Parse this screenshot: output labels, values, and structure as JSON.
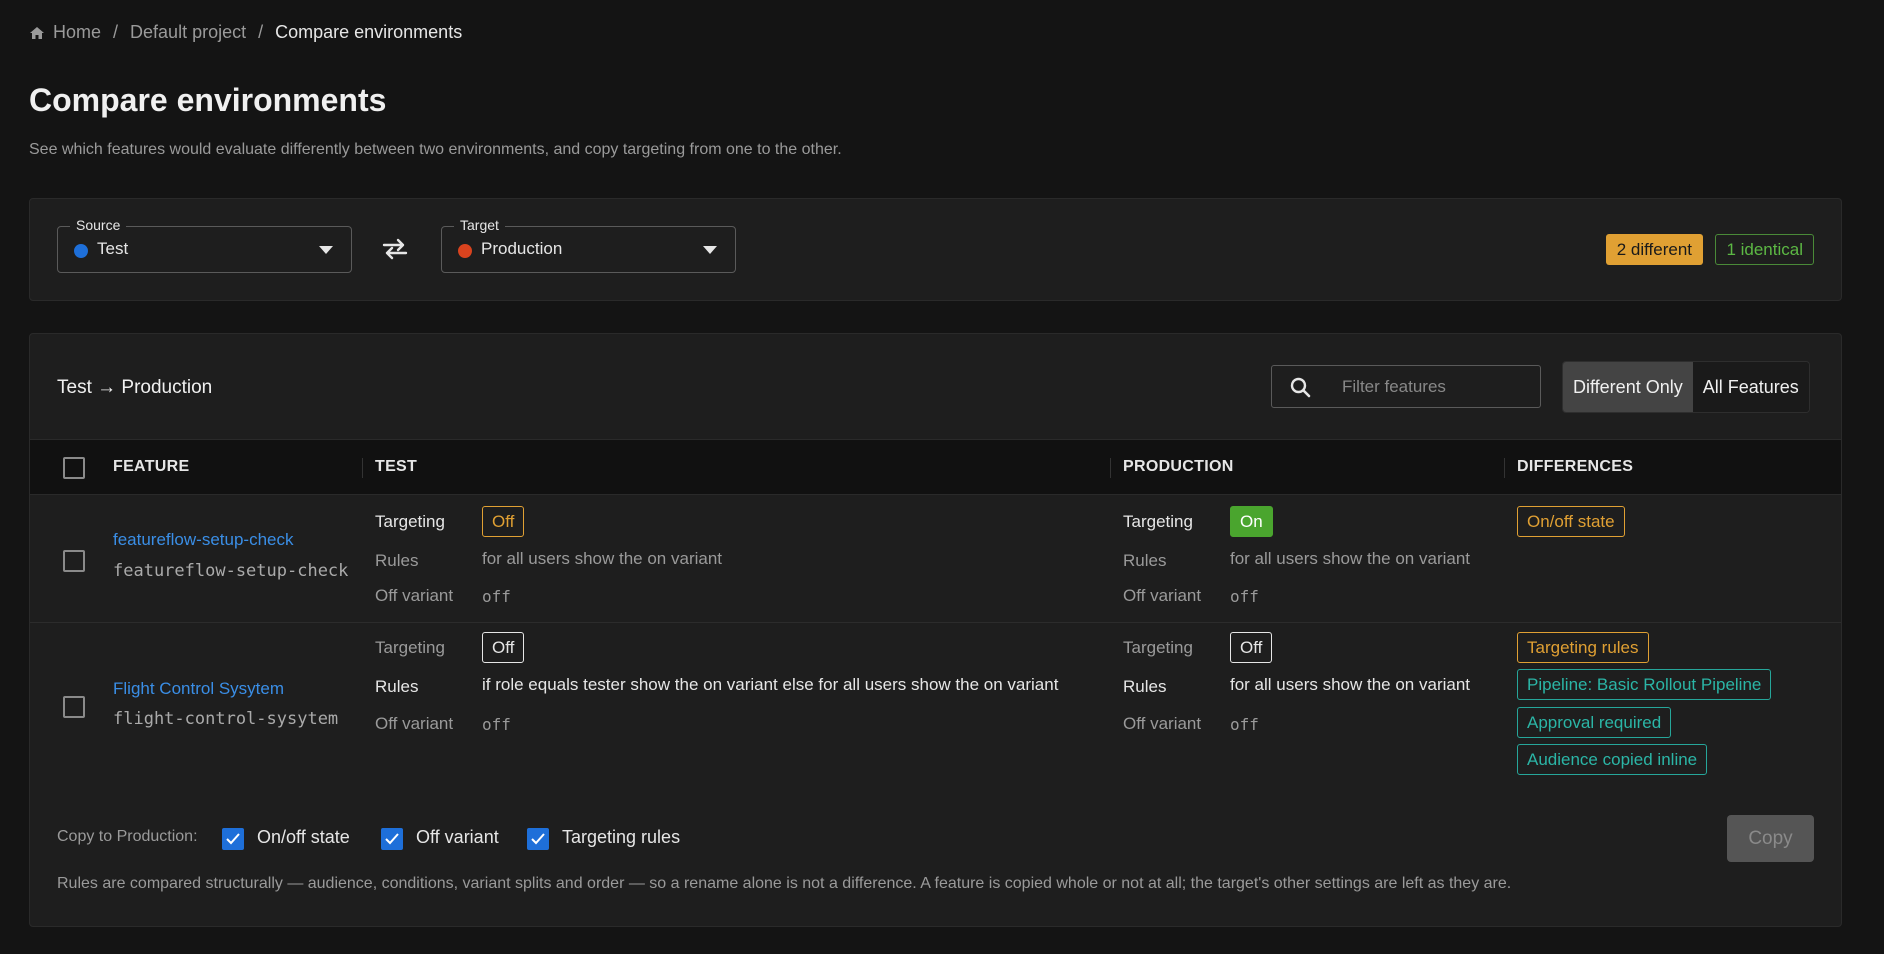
{
  "breadcrumb": {
    "home": "Home",
    "project": "Default project",
    "current": "Compare environments",
    "separator": "/"
  },
  "page": {
    "title": "Compare environments",
    "subtitle": "See which features would evaluate differently between two environments, and copy targeting from one to the other."
  },
  "selectors": {
    "source": {
      "legend": "Source",
      "value": "Test",
      "dot_color": "#1e6fd9"
    },
    "target": {
      "legend": "Target",
      "value": "Production",
      "dot_color": "#d9431e"
    }
  },
  "summary": {
    "different": "2 different",
    "identical": "1 identical"
  },
  "compare": {
    "title": "Test → Production",
    "filter_placeholder": "Filter features",
    "toggle": {
      "different_only": "Different Only",
      "all_features": "All Features",
      "active": "different_only"
    }
  },
  "table": {
    "headers": {
      "feature": "FEATURE",
      "source": "TEST",
      "target": "PRODUCTION",
      "differences": "DIFFERENCES"
    },
    "labels": {
      "targeting": "Targeting",
      "rules": "Rules",
      "off_variant": "Off variant"
    },
    "rows": [
      {
        "name": "featureflow-setup-check",
        "key": "featureflow-setup-check",
        "source": {
          "targeting": "Off",
          "rules": "for all users show the on variant",
          "off_variant": "off"
        },
        "target": {
          "targeting": "On",
          "rules": "for all users show the on variant",
          "off_variant": "off"
        },
        "differences": [
          "On/off state"
        ]
      },
      {
        "name": "Flight Control Sysytem",
        "key": "flight-control-sysytem",
        "source": {
          "targeting": "Off",
          "rules": "if role equals tester show the on variant else for all users show the on variant",
          "off_variant": "off"
        },
        "target": {
          "targeting": "Off",
          "rules": "for all users show the on variant",
          "off_variant": "off"
        },
        "differences": [
          "Targeting rules",
          "Pipeline: Basic Rollout Pipeline",
          "Approval required",
          "Audience copied inline"
        ]
      }
    ]
  },
  "copy_bar": {
    "label": "Copy to Production:",
    "options": [
      "On/off state",
      "Off variant",
      "Targeting rules"
    ],
    "button": "Copy",
    "footnote": "Rules are compared structurally — audience, conditions, variant splits and order — so a rename alone is not a difference. A feature is copied whole or not at all; the target's other settings are left as they are."
  },
  "colors": {
    "background": "#141414",
    "card": "#1e1e1e",
    "accent_blue": "#1e6fd9",
    "link_blue": "#3a8ee6",
    "warning_orange": "#e0a033",
    "success_green": "#4aa52e",
    "teal": "#26a69a"
  }
}
